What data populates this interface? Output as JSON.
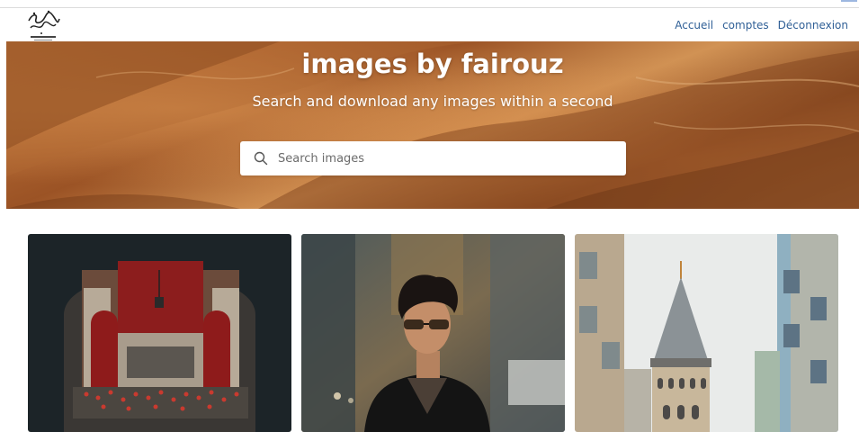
{
  "brand": {
    "logo_icon": "fairouz-calligraphy-logo"
  },
  "nav": {
    "items": [
      {
        "label": "Accueil"
      },
      {
        "label": "comptes"
      },
      {
        "label": "Déconnexion"
      }
    ],
    "link_color": "#2f5f96"
  },
  "hero": {
    "title": "images by fairouz",
    "subtitle": "Search and download any images within a second",
    "background_theme": "desert-dunes"
  },
  "search": {
    "placeholder": "Search images",
    "value": "",
    "icon": "search-icon"
  },
  "gallery": {
    "images": [
      {
        "icon": "red-hall-archway-photo"
      },
      {
        "icon": "man-with-sunglasses-photo"
      },
      {
        "icon": "galata-tower-photo"
      }
    ]
  }
}
